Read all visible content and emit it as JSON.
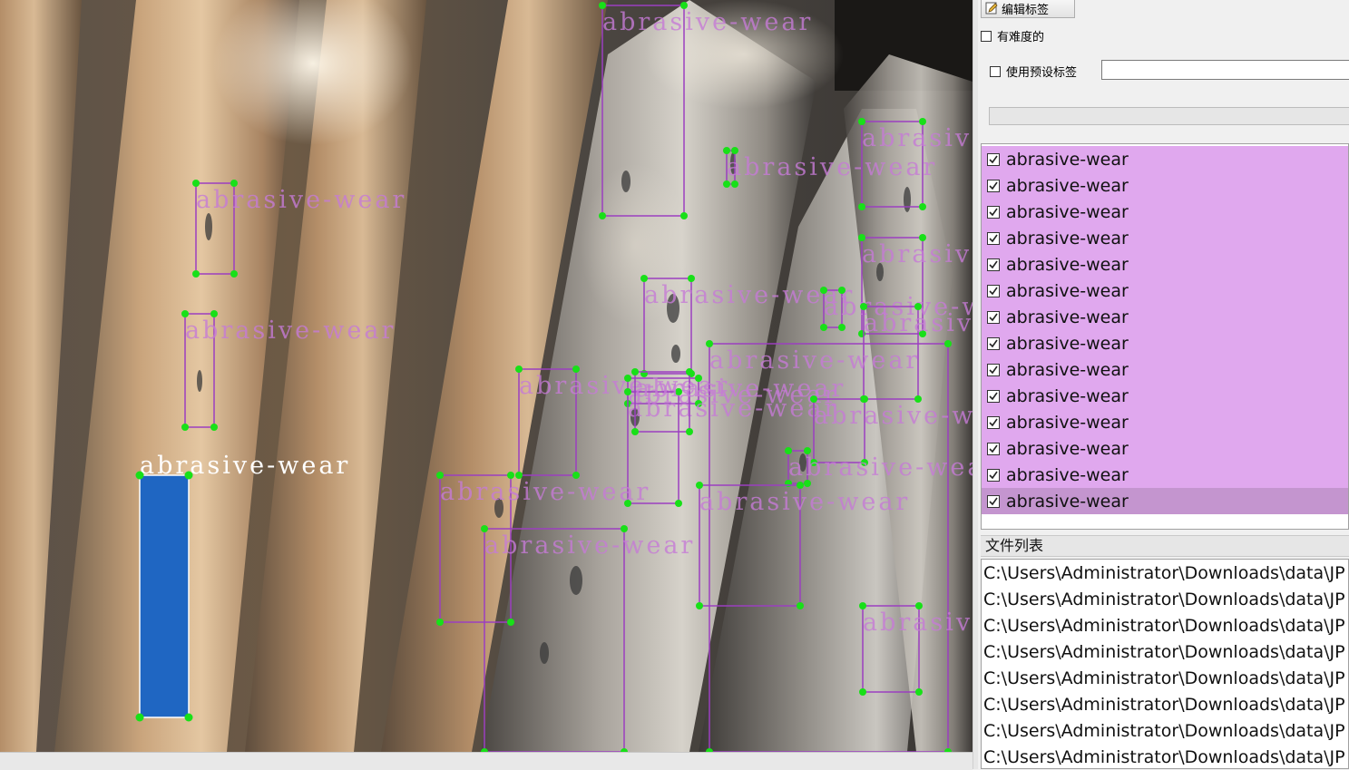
{
  "canvas": {
    "annotation_label": "abrasive-wear",
    "box_color": "#9b3fc0",
    "vertex_color": "#18e018",
    "selected_fill": "#1f66c2"
  },
  "toolbar": {
    "edit_label_button": "编辑标签",
    "difficult_checkbox": "有难度的",
    "use_default_label_checkbox": "使用预设标签",
    "default_label_value": ""
  },
  "label_list": {
    "items": [
      {
        "label": "abrasive-wear",
        "checked": true
      },
      {
        "label": "abrasive-wear",
        "checked": true
      },
      {
        "label": "abrasive-wear",
        "checked": true
      },
      {
        "label": "abrasive-wear",
        "checked": true
      },
      {
        "label": "abrasive-wear",
        "checked": true
      },
      {
        "label": "abrasive-wear",
        "checked": true
      },
      {
        "label": "abrasive-wear",
        "checked": true
      },
      {
        "label": "abrasive-wear",
        "checked": true
      },
      {
        "label": "abrasive-wear",
        "checked": true
      },
      {
        "label": "abrasive-wear",
        "checked": true
      },
      {
        "label": "abrasive-wear",
        "checked": true
      },
      {
        "label": "abrasive-wear",
        "checked": true
      },
      {
        "label": "abrasive-wear",
        "checked": true
      },
      {
        "label": "abrasive-wear",
        "checked": true,
        "selected": true
      }
    ],
    "item_color": "#e0a8ee",
    "selected_color": "#c495cf"
  },
  "file_list": {
    "title": "文件列表",
    "items": [
      "C:\\Users\\Administrator\\Downloads\\data\\JP",
      "C:\\Users\\Administrator\\Downloads\\data\\JP",
      "C:\\Users\\Administrator\\Downloads\\data\\JP",
      "C:\\Users\\Administrator\\Downloads\\data\\JP",
      "C:\\Users\\Administrator\\Downloads\\data\\JP",
      "C:\\Users\\Administrator\\Downloads\\data\\JP",
      "C:\\Users\\Administrator\\Downloads\\data\\JP",
      "C:\\Users\\Administrator\\Downloads\\data\\JP"
    ]
  }
}
